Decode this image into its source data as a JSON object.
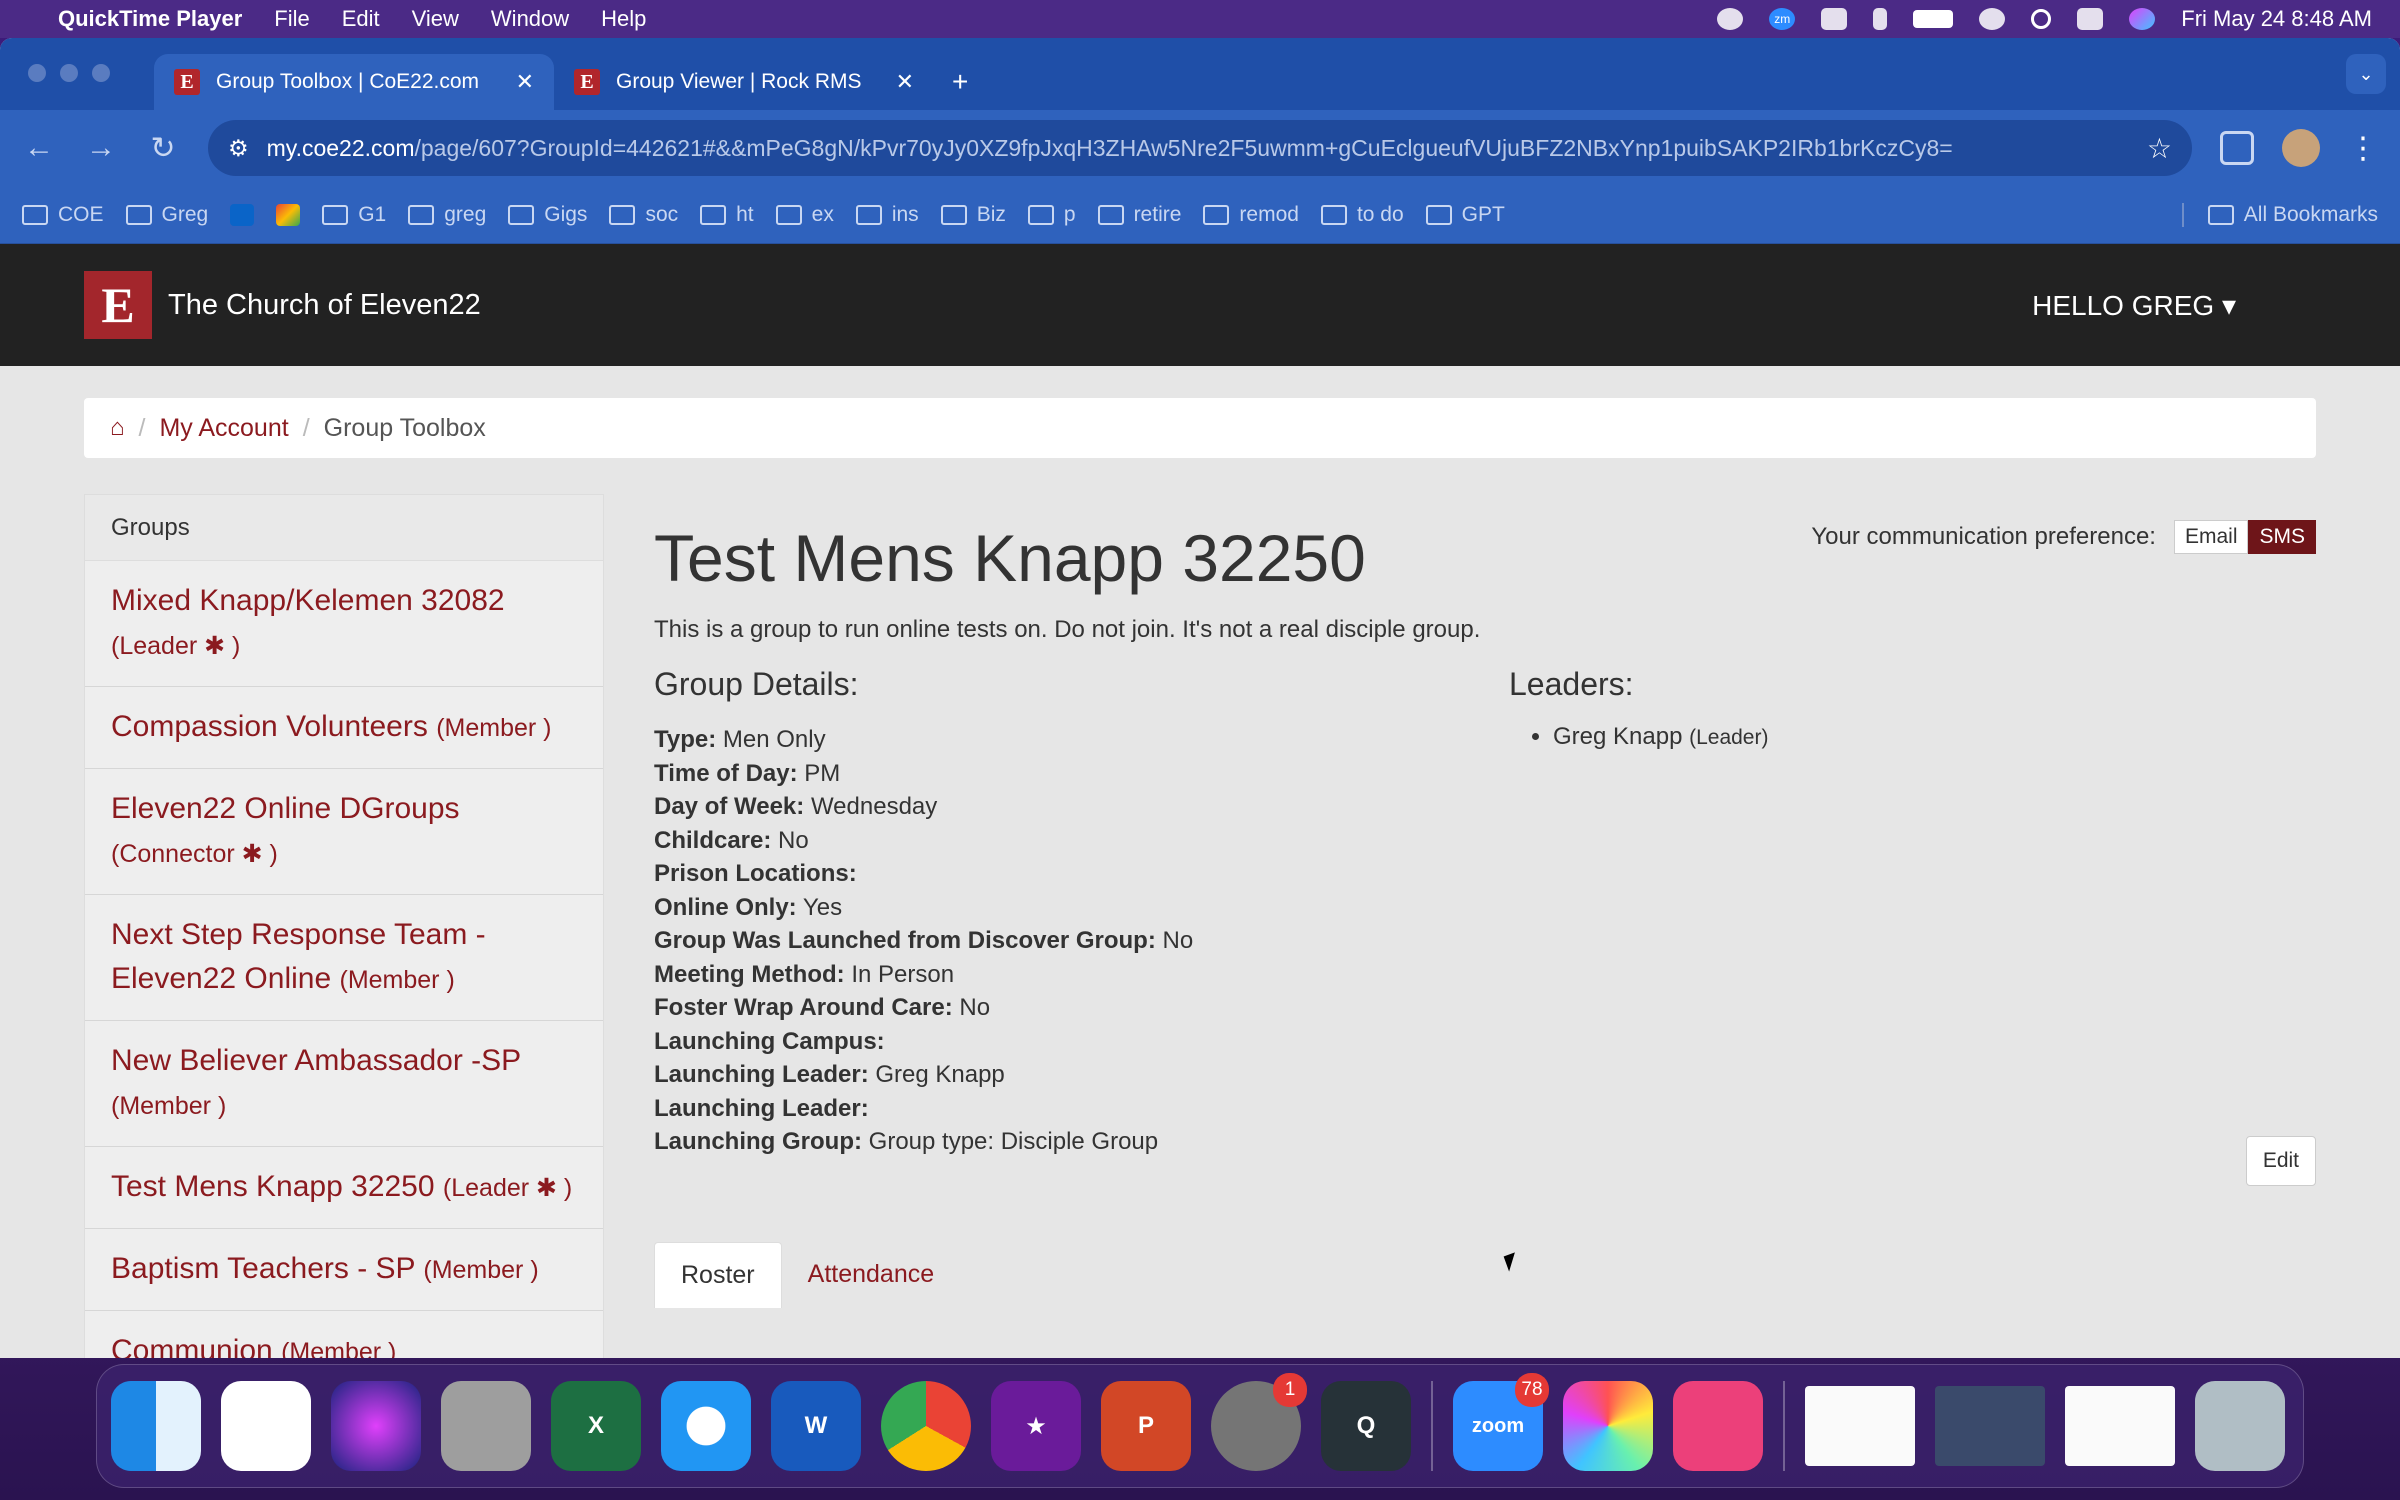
{
  "menubar": {
    "app_name": "QuickTime Player",
    "items": [
      "File",
      "Edit",
      "View",
      "Window",
      "Help"
    ],
    "clock": "Fri May 24  8:48 AM",
    "zoom_label": "zm"
  },
  "browser": {
    "tabs": [
      {
        "title": "Group Toolbox | CoE22.com",
        "favicon": "E"
      },
      {
        "title": "Group Viewer | Rock RMS",
        "favicon": "E"
      }
    ],
    "url_domain": "my.coe22.com",
    "url_path": "/page/607?GroupId=442621#&&mPeG8gN/kPvr70yJy0XZ9fpJxqH3ZHAw5Nre2F5uwmm+gCuEclgueufVUjuBFZ2NBxYnp1puibSAKP2IRb1brKczCy8=",
    "bookmarks": [
      "COE",
      "Greg",
      "G1",
      "greg",
      "Gigs",
      "soc",
      "ht",
      "ex",
      "ins",
      "Biz",
      "p",
      "retire",
      "remod",
      "to do",
      "GPT"
    ],
    "all_bookmarks": "All Bookmarks"
  },
  "site": {
    "logo_letter": "E",
    "name": "The Church of Eleven22",
    "hello": "HELLO GREG ▾",
    "breadcrumb": {
      "account": "My Account",
      "current": "Group Toolbox"
    }
  },
  "sidebar": {
    "heading": "Groups",
    "groups": [
      {
        "name": "Mixed Knapp/Kelemen 32082",
        "role": "(Leader ✱ )"
      },
      {
        "name": "Compassion Volunteers",
        "role": "(Member )"
      },
      {
        "name": "Eleven22 Online DGroups",
        "role": "(Connector ✱ )"
      },
      {
        "name": "Next Step Response Team - Eleven22 Online",
        "role": "(Member )"
      },
      {
        "name": "New Believer Ambassador -SP",
        "role": "(Member )"
      },
      {
        "name": "Test Mens Knapp 32250",
        "role": "(Leader ✱ )"
      },
      {
        "name": "Baptism Teachers - SP",
        "role": "(Member )"
      },
      {
        "name": "Communion",
        "role": "(Member )"
      }
    ]
  },
  "group": {
    "title": "Test Mens Knapp 32250",
    "description": "This is a group to run online tests on. Do not join. It's not a real disciple group.",
    "comm_label": "Your communication preference:",
    "comm_email": "Email",
    "comm_sms": "SMS",
    "details_heading": "Group Details:",
    "leaders_heading": "Leaders:",
    "details": [
      {
        "k": "Type:",
        "v": "Men Only"
      },
      {
        "k": "Time of Day:",
        "v": "PM"
      },
      {
        "k": "Day of Week:",
        "v": "Wednesday"
      },
      {
        "k": "Childcare:",
        "v": "No"
      },
      {
        "k": "Prison Locations:",
        "v": ""
      },
      {
        "k": "Online Only:",
        "v": "Yes"
      },
      {
        "k": "Group Was Launched from Discover Group:",
        "v": "No"
      },
      {
        "k": "Meeting Method:",
        "v": "In Person"
      },
      {
        "k": "Foster Wrap Around Care:",
        "v": "No"
      },
      {
        "k": "Launching Campus:",
        "v": ""
      },
      {
        "k": "Launching Leader:",
        "v": "Greg Knapp"
      },
      {
        "k": "Launching Leader:",
        "v": ""
      },
      {
        "k": "Launching Group:",
        "v": "Group type: Disciple Group"
      }
    ],
    "leader_name": "Greg Knapp",
    "leader_role": "(Leader)",
    "edit_label": "Edit",
    "tabs": [
      "Roster",
      "Attendance"
    ]
  },
  "dock": {
    "zoom_badge": "78",
    "settings_badge": "1",
    "zoom_label": "zoom"
  }
}
